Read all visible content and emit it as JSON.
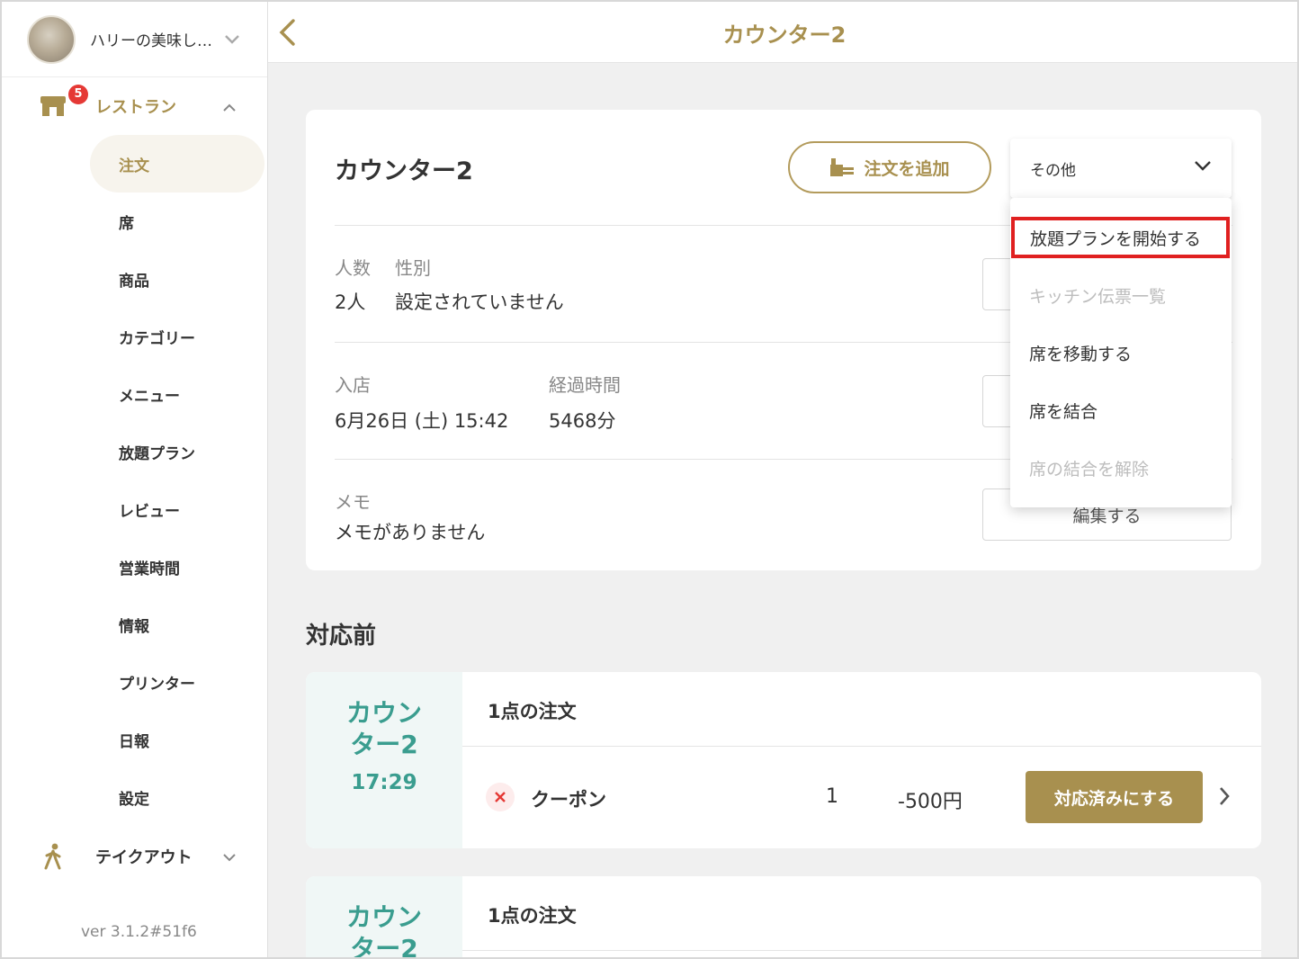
{
  "app": {
    "store_name": "ハリーの美味し…",
    "version": "ver 3.1.2#51f6",
    "accent_color": "#a8904f",
    "seat_color": "#3a9d8f"
  },
  "sidebar": {
    "restaurant": {
      "label": "レストラン",
      "badge": "5",
      "icon": "store-icon"
    },
    "items": [
      {
        "label": "注文",
        "active": true
      },
      {
        "label": "席"
      },
      {
        "label": "商品"
      },
      {
        "label": "カテゴリー"
      },
      {
        "label": "メニュー"
      },
      {
        "label": "放題プラン"
      },
      {
        "label": "レビュー"
      },
      {
        "label": "営業時間"
      },
      {
        "label": "情報"
      },
      {
        "label": "プリンター"
      },
      {
        "label": "日報"
      },
      {
        "label": "設定"
      }
    ],
    "takeout": {
      "label": "テイクアウト",
      "icon": "walking-person-icon"
    }
  },
  "header": {
    "title": "カウンター2"
  },
  "card": {
    "title": "カウンター2",
    "add_order_label": "注文を追加",
    "other_select_value": "その他",
    "people_label": "人数",
    "people_value": "2人",
    "gender_label": "性別",
    "gender_value": "設定されていません",
    "checkin_label": "入店",
    "checkin_value": "6月26日 (土) 15:42",
    "elapsed_label": "経過時間",
    "elapsed_value": "5468分",
    "memo_label": "メモ",
    "memo_value": "メモがありません",
    "edit_label": "編集する"
  },
  "dropdown": {
    "items": [
      {
        "label": "放題プランを開始する",
        "disabled": false,
        "highlighted": true
      },
      {
        "label": "キッチン伝票一覧",
        "disabled": true
      },
      {
        "label": "席を移動する",
        "disabled": false
      },
      {
        "label": "席を結合",
        "disabled": false
      },
      {
        "label": "席の結合を解除",
        "disabled": true
      }
    ]
  },
  "section": {
    "title": "対応前"
  },
  "orders": [
    {
      "seat_line1": "カウン",
      "seat_line2": "ター2",
      "time": "17:29",
      "head": "1点の注文",
      "item_name": "クーポン",
      "qty": "1",
      "price": "-500円",
      "done_label": "対応済みにする"
    },
    {
      "seat_line1": "カウン",
      "seat_line2": "ター2",
      "head": "1点の注文"
    }
  ]
}
